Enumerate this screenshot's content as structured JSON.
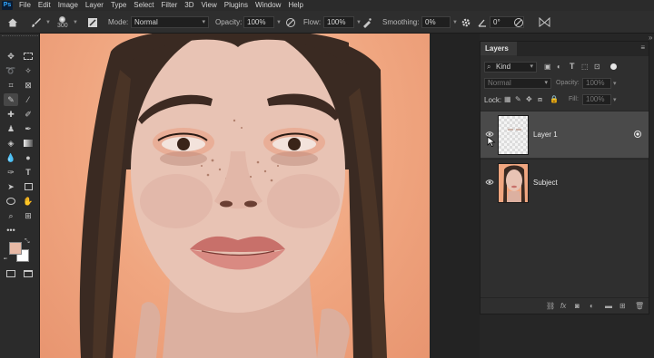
{
  "app": {
    "logo": "Ps"
  },
  "menu": [
    "File",
    "Edit",
    "Image",
    "Layer",
    "Type",
    "Select",
    "Filter",
    "3D",
    "View",
    "Plugins",
    "Window",
    "Help"
  ],
  "options": {
    "brush_size": "300",
    "mode_label": "Mode:",
    "mode_value": "Normal",
    "opacity_label": "Opacity:",
    "opacity_value": "100%",
    "flow_label": "Flow:",
    "flow_value": "100%",
    "smoothing_label": "Smoothing:",
    "smoothing_value": "0%",
    "angle_value": "0°"
  },
  "layers_panel": {
    "tab": "Layers",
    "filter_kind": "Kind",
    "blend_mode": "Normal",
    "opacity_label": "Opacity:",
    "opacity_value": "100%",
    "lock_label": "Lock:",
    "fill_label": "Fill:",
    "fill_value": "100%",
    "layers": [
      {
        "name": "Layer 1",
        "selected": true
      },
      {
        "name": "Subject",
        "selected": false
      }
    ]
  },
  "colors": {
    "foreground": "#e8b9a5",
    "background": "#ffffff",
    "accent": "#31a8ff"
  }
}
